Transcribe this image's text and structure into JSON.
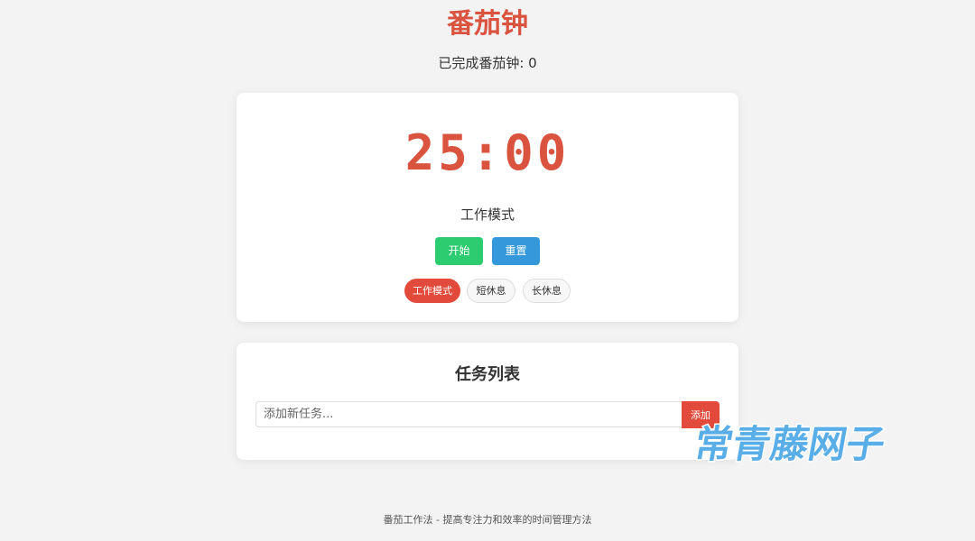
{
  "header": {
    "title": "番茄钟",
    "completed_label": "已完成番茄钟: 0"
  },
  "timer": {
    "display": "25:00",
    "mode_label": "工作模式",
    "start_label": "开始",
    "reset_label": "重置",
    "modes": {
      "work": "工作模式",
      "short_break": "短休息",
      "long_break": "长休息"
    },
    "active_mode": "work",
    "colors": {
      "accent": "#d9533f",
      "start": "#2ecc71",
      "reset": "#3498db"
    }
  },
  "tasks": {
    "title": "任务列表",
    "input_placeholder": "添加新任务...",
    "add_label": "添加",
    "items": []
  },
  "footer": {
    "text": "番茄工作法 - 提高专注力和效率的时间管理方法"
  },
  "watermark": {
    "text": "常青藤网子",
    "color": "#5aaee8"
  }
}
